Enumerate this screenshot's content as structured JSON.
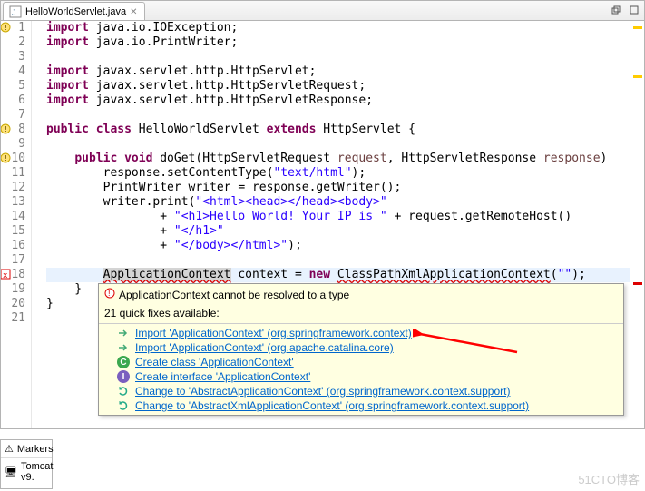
{
  "tab": {
    "title": "HelloWorldServlet.java"
  },
  "tooltip": {
    "error": "ApplicationContext cannot be resolved to a type",
    "subtitle": "21 quick fixes available:",
    "fixes": [
      {
        "icon": "import",
        "text": "Import 'ApplicationContext' (org.springframework.context)"
      },
      {
        "icon": "import",
        "text": "Import 'ApplicationContext' (org.apache.catalina.core)"
      },
      {
        "icon": "class",
        "text": "Create class 'ApplicationContext'"
      },
      {
        "icon": "interface",
        "text": "Create interface 'ApplicationContext'"
      },
      {
        "icon": "change",
        "text": "Change to 'AbstractApplicationContext' (org.springframework.context.support)"
      },
      {
        "icon": "change",
        "text": "Change to 'AbstractXmlApplicationContext' (org.springframework.context.support)"
      }
    ]
  },
  "code": {
    "lines": [
      {
        "n": 1,
        "marker": "warn",
        "tokens": [
          [
            "kw",
            "import"
          ],
          [
            "",
            " java.io.IOException;"
          ]
        ]
      },
      {
        "n": 2,
        "tokens": [
          [
            "kw",
            "import"
          ],
          [
            "",
            " java.io.PrintWriter;"
          ]
        ]
      },
      {
        "n": 3,
        "tokens": [
          [
            "",
            ""
          ]
        ]
      },
      {
        "n": 4,
        "tokens": [
          [
            "kw",
            "import"
          ],
          [
            "",
            " javax.servlet.http.HttpServlet;"
          ]
        ]
      },
      {
        "n": 5,
        "tokens": [
          [
            "kw",
            "import"
          ],
          [
            "",
            " javax.servlet.http.HttpServletRequest;"
          ]
        ]
      },
      {
        "n": 6,
        "tokens": [
          [
            "kw",
            "import"
          ],
          [
            "",
            " javax.servlet.http.HttpServletResponse;"
          ]
        ]
      },
      {
        "n": 7,
        "tokens": [
          [
            "",
            ""
          ]
        ]
      },
      {
        "n": 8,
        "marker": "warn",
        "tokens": [
          [
            "kw",
            "public class "
          ],
          [
            "type",
            "HelloWorldServlet"
          ],
          [
            "kw",
            " extends "
          ],
          [
            "type",
            "HttpServlet"
          ],
          [
            "",
            " {"
          ]
        ]
      },
      {
        "n": 9,
        "tokens": [
          [
            "",
            ""
          ]
        ]
      },
      {
        "n": 10,
        "marker": "warn",
        "tokens": [
          [
            "",
            "    "
          ],
          [
            "kw",
            "public void "
          ],
          [
            "method",
            "doGet"
          ],
          [
            "",
            "(HttpServletRequest "
          ],
          [
            "param",
            "request"
          ],
          [
            "",
            ", HttpServletResponse "
          ],
          [
            "param",
            "response"
          ],
          [
            "",
            ")"
          ]
        ]
      },
      {
        "n": 11,
        "tokens": [
          [
            "",
            "        response.setContentType("
          ],
          [
            "str",
            "\"text/html\""
          ],
          [
            "",
            ");"
          ]
        ]
      },
      {
        "n": 12,
        "tokens": [
          [
            "",
            "        PrintWriter writer = response.getWriter();"
          ]
        ]
      },
      {
        "n": 13,
        "tokens": [
          [
            "",
            "        writer.print("
          ],
          [
            "str",
            "\"<html><head></head><body>\""
          ]
        ]
      },
      {
        "n": 14,
        "tokens": [
          [
            "",
            "                + "
          ],
          [
            "str",
            "\"<h1>Hello World! Your IP is \""
          ],
          [
            "",
            " + request.getRemoteHost()"
          ]
        ]
      },
      {
        "n": 15,
        "tokens": [
          [
            "",
            "                + "
          ],
          [
            "str",
            "\"</h1>\""
          ]
        ]
      },
      {
        "n": 16,
        "tokens": [
          [
            "",
            "                + "
          ],
          [
            "str",
            "\"</body></html>\""
          ],
          [
            "",
            ");"
          ]
        ]
      },
      {
        "n": 17,
        "tokens": [
          [
            "",
            ""
          ]
        ]
      },
      {
        "n": 18,
        "marker": "error",
        "hl": true,
        "tokens": [
          [
            "",
            "        "
          ],
          [
            "err",
            "ApplicationContext"
          ],
          [
            "",
            " context = "
          ],
          [
            "kw",
            "new "
          ],
          [
            "err2",
            "ClassPathXmlApplicationContext"
          ],
          [
            "",
            "("
          ],
          [
            "str",
            "\"\""
          ],
          [
            "",
            ");"
          ]
        ]
      },
      {
        "n": 19,
        "tokens": [
          [
            "",
            "    }"
          ]
        ]
      },
      {
        "n": 20,
        "tokens": [
          [
            "",
            "}"
          ]
        ]
      },
      {
        "n": 21,
        "tokens": [
          [
            "",
            ""
          ]
        ]
      }
    ]
  },
  "markers": {
    "bottom": {
      "label": "Markers"
    },
    "tomcat": {
      "label": "Tomcat v9."
    }
  },
  "watermark": "51CTO博客"
}
